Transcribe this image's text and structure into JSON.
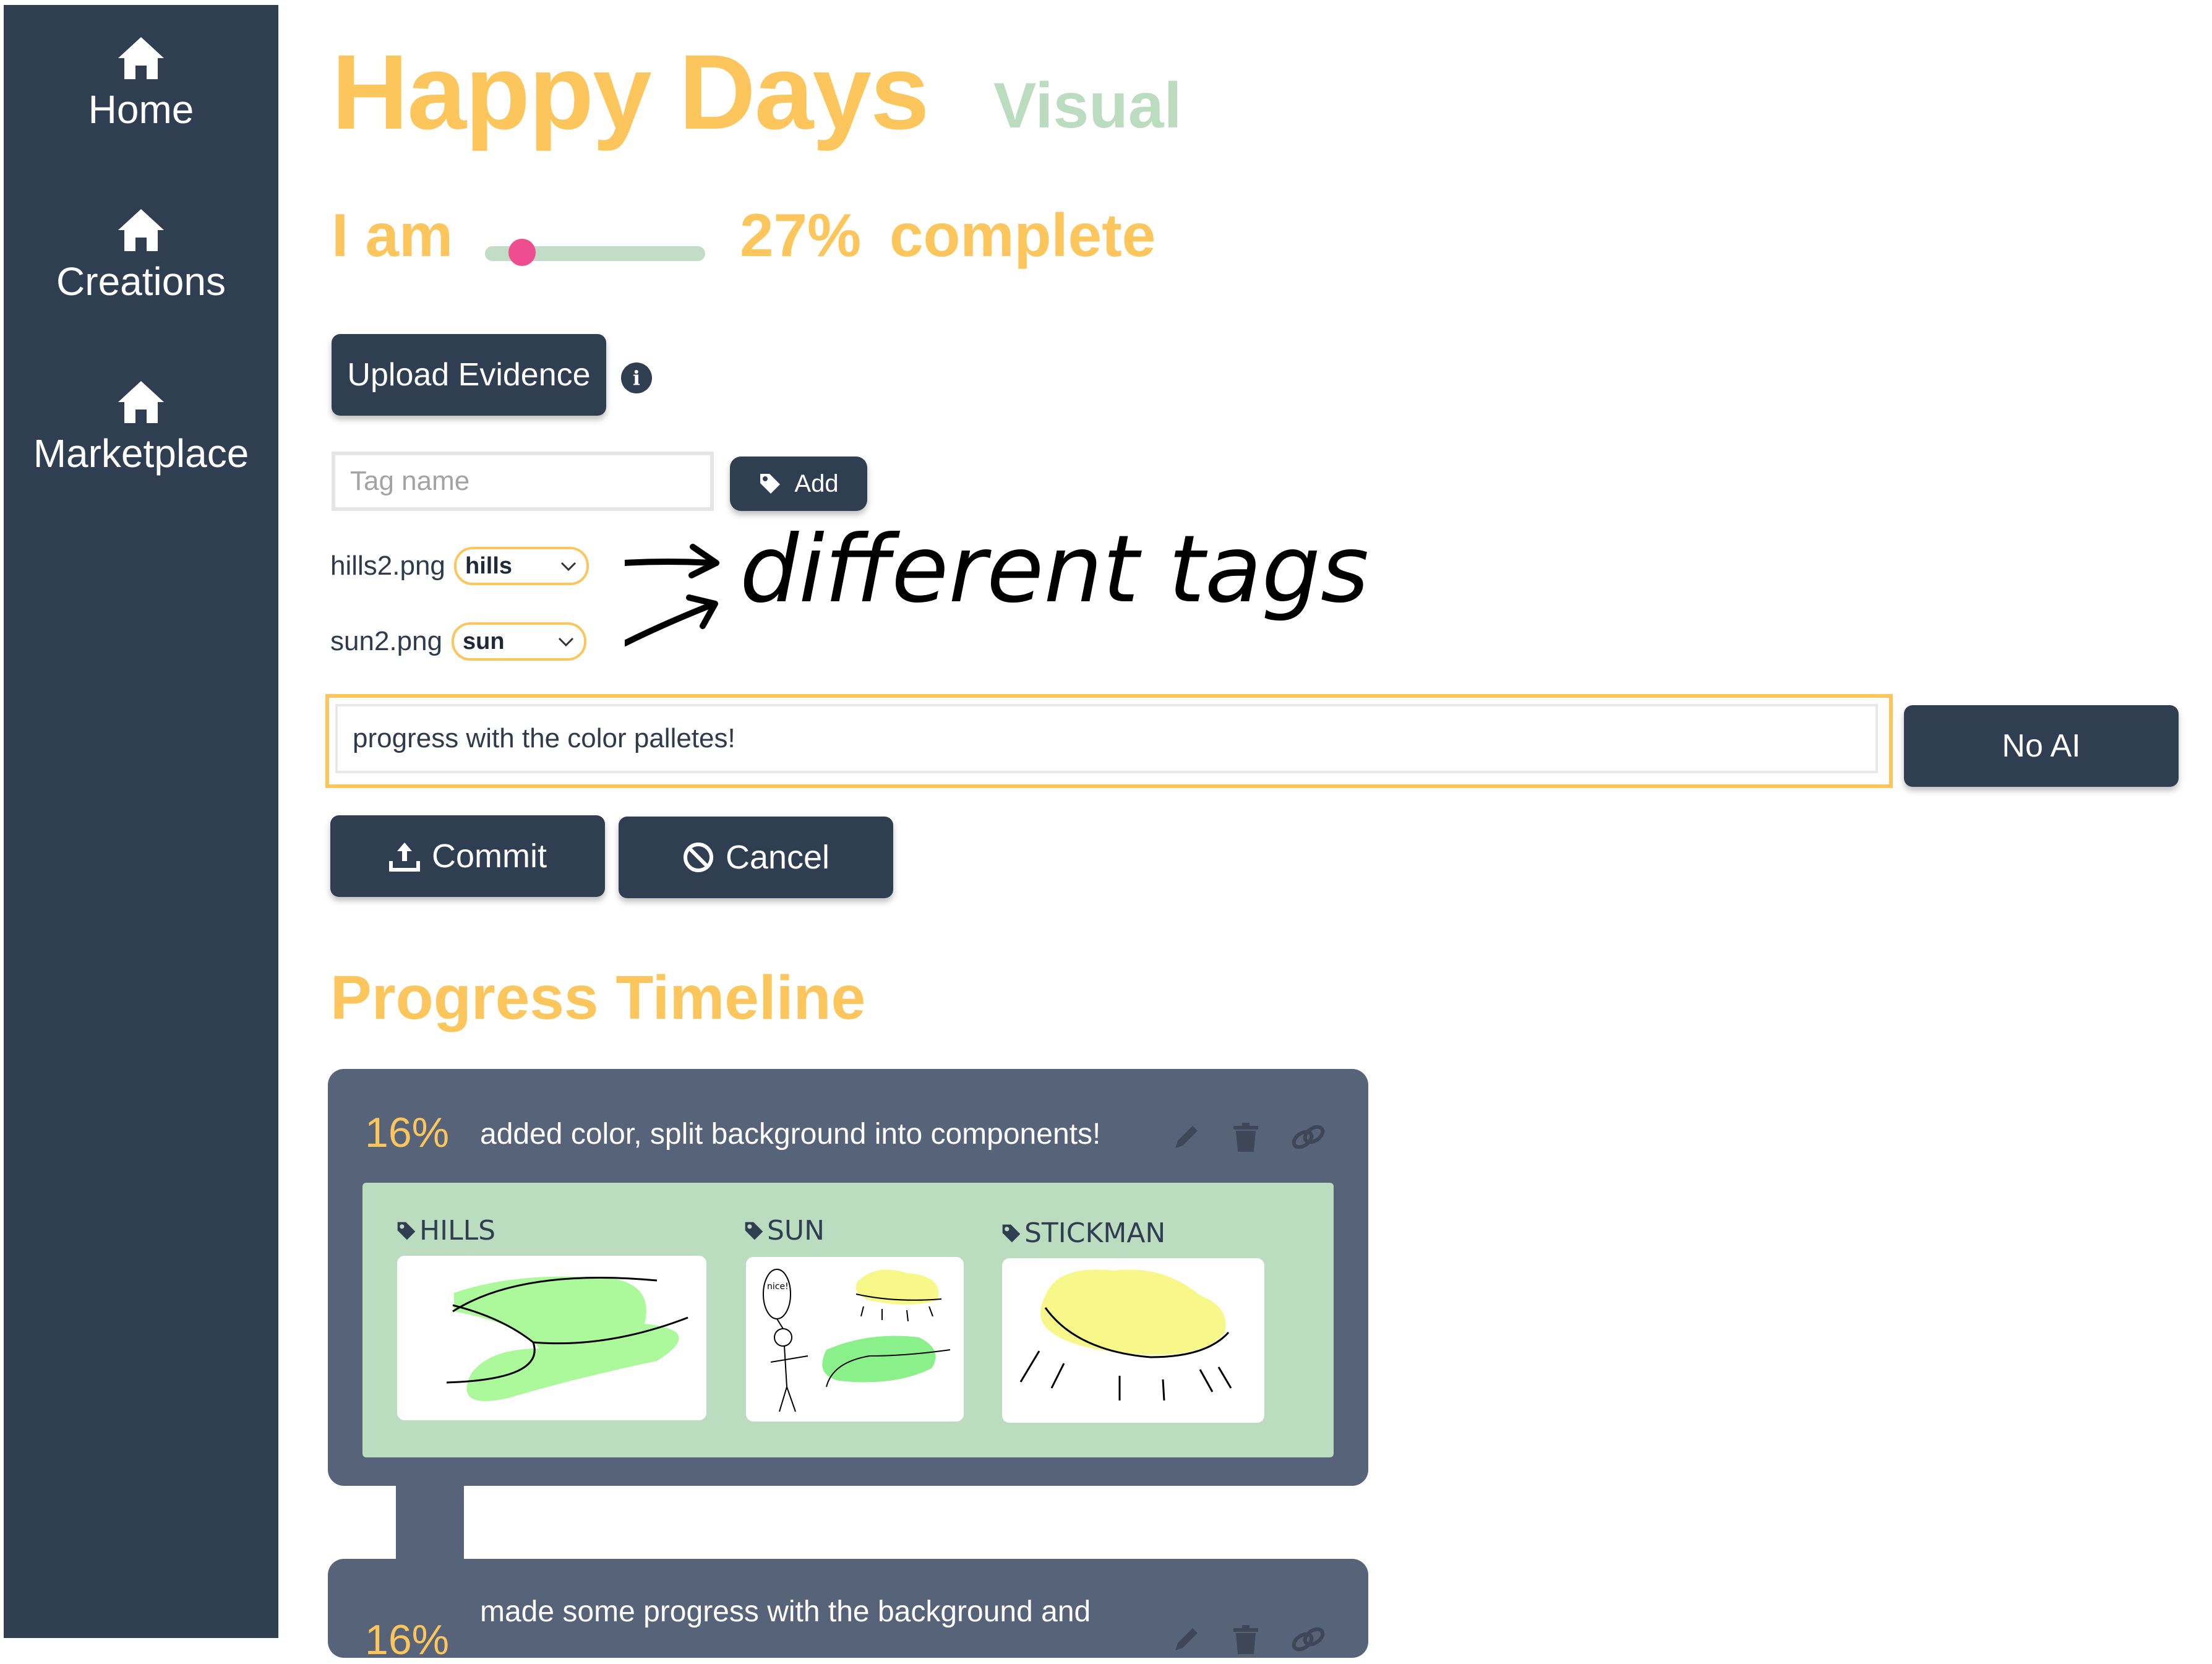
{
  "nav": {
    "items": [
      {
        "label": "Home",
        "icon": "home-icon"
      },
      {
        "label": "Creations",
        "icon": "home-icon"
      },
      {
        "label": "Marketplace",
        "icon": "home-icon"
      }
    ]
  },
  "header": {
    "title": "Happy Days",
    "subtitle": "Visual"
  },
  "progress": {
    "prefix": "I am",
    "percent_text": "27%",
    "suffix": "complete",
    "slider_value": 0.27
  },
  "upload": {
    "label": "Upload Evidence",
    "info_icon": "info-icon"
  },
  "tags": {
    "placeholder": "Tag name",
    "add_label": "Add"
  },
  "files": [
    {
      "name": "hills2.png",
      "tag": "hills"
    },
    {
      "name": "sun2.png",
      "tag": "sun"
    }
  ],
  "annotation": {
    "text": "different tags"
  },
  "commit_message": {
    "value": "progress with the color palletes!",
    "no_ai_label": "No AI"
  },
  "actions": {
    "commit_label": "Commit",
    "cancel_label": "Cancel"
  },
  "timeline": {
    "title": "Progress Timeline",
    "entries": [
      {
        "percent": "16%",
        "message": "added color, split background into components!",
        "tags": [
          "HILLS",
          "SUN",
          "STICKMAN"
        ],
        "doodle_text": "nice!"
      },
      {
        "percent": "16%",
        "message": "made some progress with the background and"
      }
    ]
  },
  "colors": {
    "sidebar": "#2f3e51",
    "accent_yellow": "#fcc65c",
    "accent_green": "#bcdcc0",
    "slider_thumb": "#ee4e8f",
    "card": "#566379"
  }
}
